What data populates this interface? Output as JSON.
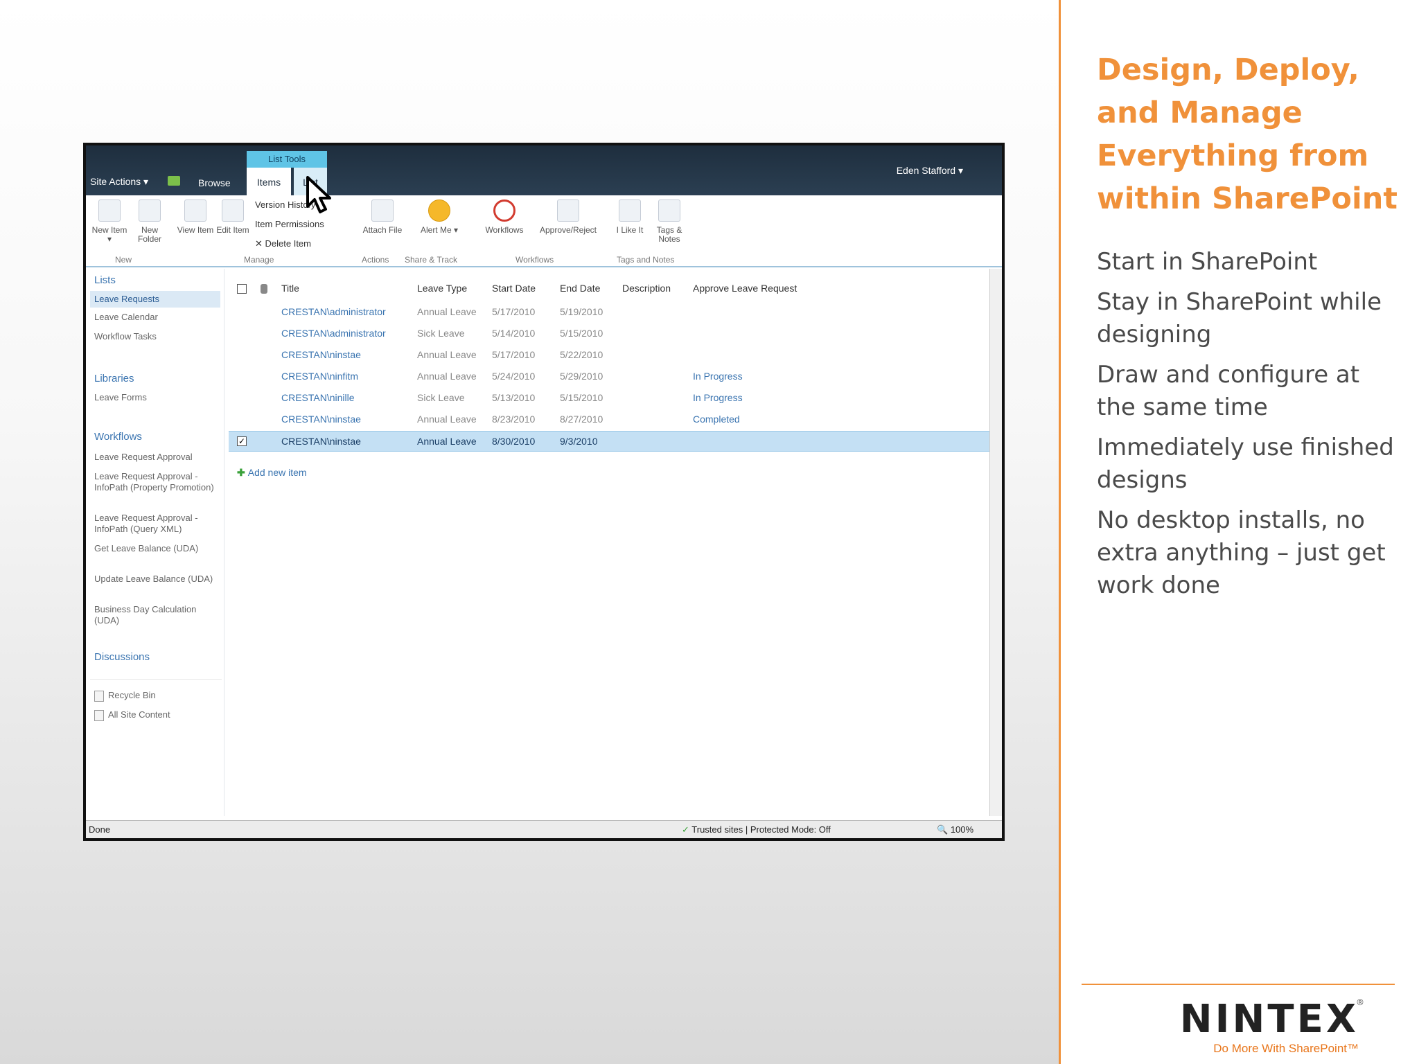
{
  "slide": {
    "headline": "Design, Deploy, and Manage Everything from within SharePoint",
    "bullets": [
      "Start in SharePoint",
      "Stay in SharePoint while designing",
      "Draw and configure at the same time",
      "Immediately use finished designs",
      "No desktop installs, no extra anything – just get work done"
    ],
    "logo": {
      "word": "NINTEX",
      "reg": "®",
      "tagline": "Do More With SharePoint™"
    },
    "colors": {
      "accent": "#f0913a",
      "text": "#4a4a4a"
    }
  },
  "sharepoint": {
    "topbar": {
      "list_tools": "List Tools",
      "site_actions": "Site Actions ▾",
      "tab_browse": "Browse",
      "tab_items": "Items",
      "tab_list": "List",
      "user": "Eden Stafford ▾"
    },
    "ribbon": {
      "new_item": "New Item ▾",
      "new_folder": "New Folder",
      "view_item": "View Item",
      "edit_item": "Edit Item",
      "version_history": "Version History",
      "item_permissions": "Item Permissions",
      "delete_item": "Delete Item",
      "attach_file": "Attach File",
      "alert_me": "Alert Me ▾",
      "workflows": "Workflows",
      "approve_reject": "Approve/Reject",
      "i_like_it": "I Like It",
      "tags_notes": "Tags & Notes",
      "groups": {
        "new": "New",
        "manage": "Manage",
        "actions": "Actions",
        "share_track": "Share & Track",
        "workflows": "Workflows",
        "tags_notes": "Tags and Notes"
      }
    },
    "nav": {
      "lists_heading": "Lists",
      "lists": [
        "Leave Requests",
        "Leave Calendar",
        "Workflow Tasks"
      ],
      "libraries_heading": "Libraries",
      "libraries": [
        "Leave Forms"
      ],
      "workflows_heading": "Workflows",
      "workflows": [
        "Leave Request Approval",
        "Leave Request Approval - InfoPath (Property Promotion)",
        "Leave Request Approval - InfoPath (Query XML)",
        "Get Leave Balance (UDA)",
        "Update Leave Balance (UDA)",
        "Business Day Calculation (UDA)"
      ],
      "discussions_heading": "Discussions",
      "recycle_bin": "Recycle Bin",
      "all_site_content": "All Site Content"
    },
    "list": {
      "columns": [
        "Title",
        "Leave Type",
        "Start Date",
        "End Date",
        "Description",
        "Approve Leave Request"
      ],
      "rows": [
        {
          "title": "CRESTAN\\administrator",
          "type": "Annual Leave",
          "start": "5/17/2010",
          "end": "5/19/2010",
          "approve": ""
        },
        {
          "title": "CRESTAN\\administrator",
          "type": "Sick Leave",
          "start": "5/14/2010",
          "end": "5/15/2010",
          "approve": ""
        },
        {
          "title": "CRESTAN\\ninstae",
          "type": "Annual Leave",
          "start": "5/17/2010",
          "end": "5/22/2010",
          "approve": ""
        },
        {
          "title": "CRESTAN\\ninfitm",
          "type": "Annual Leave",
          "start": "5/24/2010",
          "end": "5/29/2010",
          "approve": "In Progress"
        },
        {
          "title": "CRESTAN\\ninille",
          "type": "Sick Leave",
          "start": "5/13/2010",
          "end": "5/15/2010",
          "approve": "In Progress"
        },
        {
          "title": "CRESTAN\\ninstae",
          "type": "Annual Leave",
          "start": "8/23/2010",
          "end": "8/27/2010",
          "approve": "Completed"
        },
        {
          "title": "CRESTAN\\ninstae",
          "type": "Annual Leave",
          "start": "8/30/2010",
          "end": "9/3/2010",
          "approve": ""
        }
      ],
      "selected_row": 6,
      "add_new": "Add new item"
    },
    "status": {
      "left": "Done",
      "zone": "Trusted sites | Protected Mode: Off",
      "zoom": "100%"
    }
  }
}
